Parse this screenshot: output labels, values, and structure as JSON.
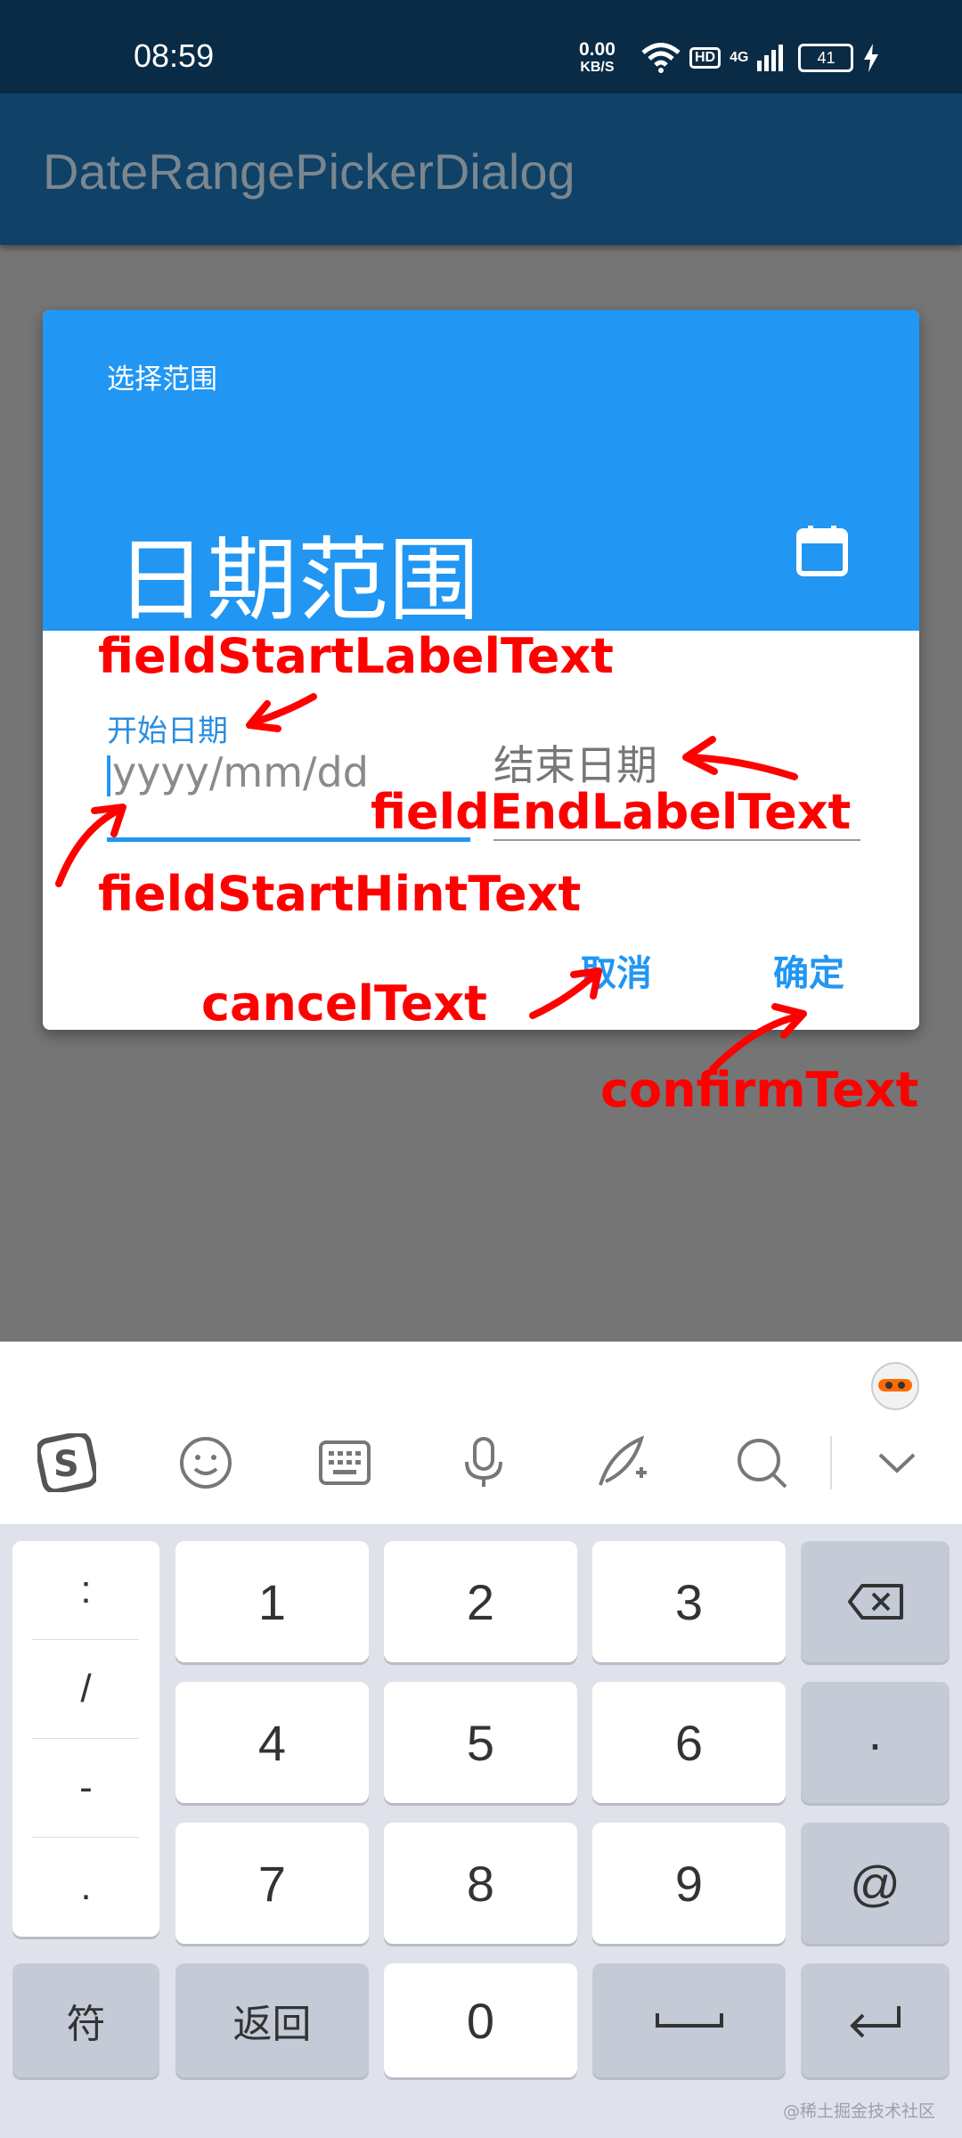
{
  "status_bar": {
    "time": "08:59",
    "net_speed_value": "0.00",
    "net_speed_unit": "KB/S",
    "hd": "HD",
    "network": "4G",
    "battery": "41"
  },
  "app_bar": {
    "title": "DateRangePickerDialog"
  },
  "dialog": {
    "help_text": "选择范围",
    "range_text": "日期范围",
    "start_label": "开始日期",
    "start_hint": "yyyy/mm/dd",
    "end_label": "结束日期",
    "cancel_label": "取消",
    "confirm_label": "确定"
  },
  "annotations": {
    "field_start_label": "fieldStartLabelText",
    "field_end_label": "fieldEndLabelText",
    "field_start_hint": "fieldStartHintText",
    "cancel": "cancelText",
    "confirm": "confirmText"
  },
  "keyboard": {
    "side_keys": [
      ":",
      "/",
      "-",
      "."
    ],
    "rows": [
      [
        "1",
        "2",
        "3"
      ],
      [
        "4",
        "5",
        "6"
      ],
      [
        "7",
        "8",
        "9"
      ]
    ],
    "right_keys": [
      "·",
      "@"
    ],
    "symbols_label": "符",
    "back_label": "返回",
    "zero": "0"
  },
  "watermark": "@稀土掘金技术社区",
  "colors": {
    "accent": "#2196f3",
    "annotation": "#ff0000",
    "app_bar": "#104166"
  }
}
